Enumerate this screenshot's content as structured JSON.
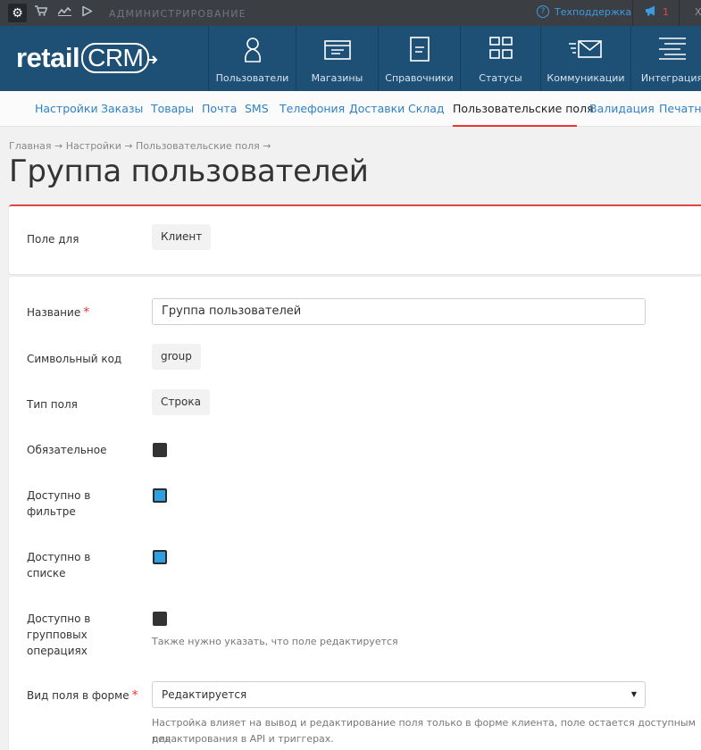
{
  "topbar": {
    "admin_label": "АДМИНИСТРИРОВАНИЕ",
    "support_label": "Техподдержка",
    "notifications_count": "1",
    "user_initial": "Х"
  },
  "logo": {
    "text": "retail",
    "crm": "CRM"
  },
  "mainnav": {
    "items": [
      {
        "label": "Пользователи",
        "icon": "user-icon"
      },
      {
        "label": "Магазины",
        "icon": "store-icon"
      },
      {
        "label": "Справочники",
        "icon": "book-icon"
      },
      {
        "label": "Статусы",
        "icon": "statuses-icon"
      },
      {
        "label": "Коммуникации",
        "icon": "communications-icon"
      },
      {
        "label": "Интеграция",
        "icon": "integration-icon"
      }
    ]
  },
  "subnav": {
    "items": [
      "Настройки",
      "Заказы",
      "Товары",
      "Почта",
      "SMS",
      "Телефония",
      "Доставки",
      "Склад",
      "Пользовательские поля",
      "Валидация",
      "Печатны"
    ],
    "active_index": 8
  },
  "breadcrumb": "Главная → Настройки → Пользовательские поля →",
  "page_title": "Группа пользователей",
  "form": {
    "field_for_label": "Поле для",
    "field_for_value": "Клиент",
    "name_label": "Название",
    "name_value": "Группа пользователей",
    "code_label": "Символьный код",
    "code_value": "group",
    "type_label": "Тип поля",
    "type_value": "Строка",
    "required_label": "Обязательное",
    "required_checked": false,
    "filter_label_1": "Доступно в",
    "filter_label_2": "фильтре",
    "filter_checked": true,
    "list_label_1": "Доступно в",
    "list_label_2": "списке",
    "list_checked": true,
    "group_label_1": "Доступно в",
    "group_label_2": "групповых",
    "group_label_3": "операциях",
    "group_checked": false,
    "group_hint": "Также нужно указать, что поле редактируется",
    "view_label": "Вид поля в форме",
    "view_value": "Редактируется",
    "view_hint_1": "Настройка влияет на вывод и редактирование поля только в форме клиента, поле остается доступным для",
    "view_hint_2": "редактирования в API и триггерах."
  },
  "colors": {
    "nav_bg": "#1e4f75",
    "topbar_bg": "#3b3f44",
    "accent": "#2f81c4",
    "danger": "#e33333"
  }
}
